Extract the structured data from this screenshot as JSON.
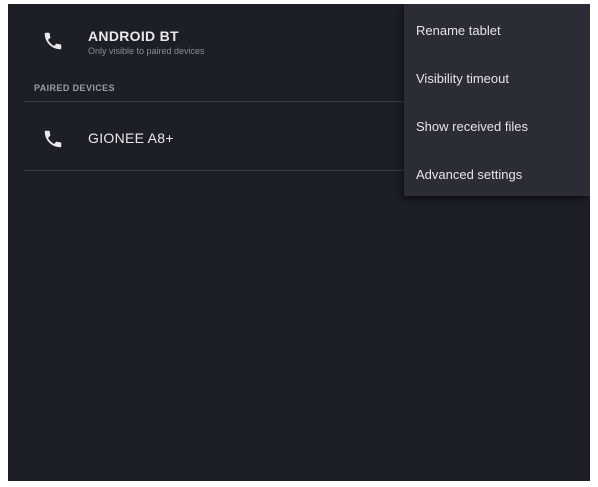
{
  "devices": {
    "self": {
      "name": "ANDROID BT",
      "subtitle": "Only visible to paired devices",
      "icon": "phone-icon"
    },
    "section_header": "PAIRED DEVICES",
    "paired": [
      {
        "name": "GIONEE A8+",
        "icon": "phone-icon"
      }
    ]
  },
  "menu": {
    "items": [
      {
        "label": "Rename tablet"
      },
      {
        "label": "Visibility timeout"
      },
      {
        "label": "Show received files"
      },
      {
        "label": "Advanced settings"
      }
    ]
  },
  "colors": {
    "background": "#1c1f26",
    "menu_background": "#2a2d35",
    "text_primary": "#e8e9ec",
    "text_secondary": "#8a8d96"
  }
}
